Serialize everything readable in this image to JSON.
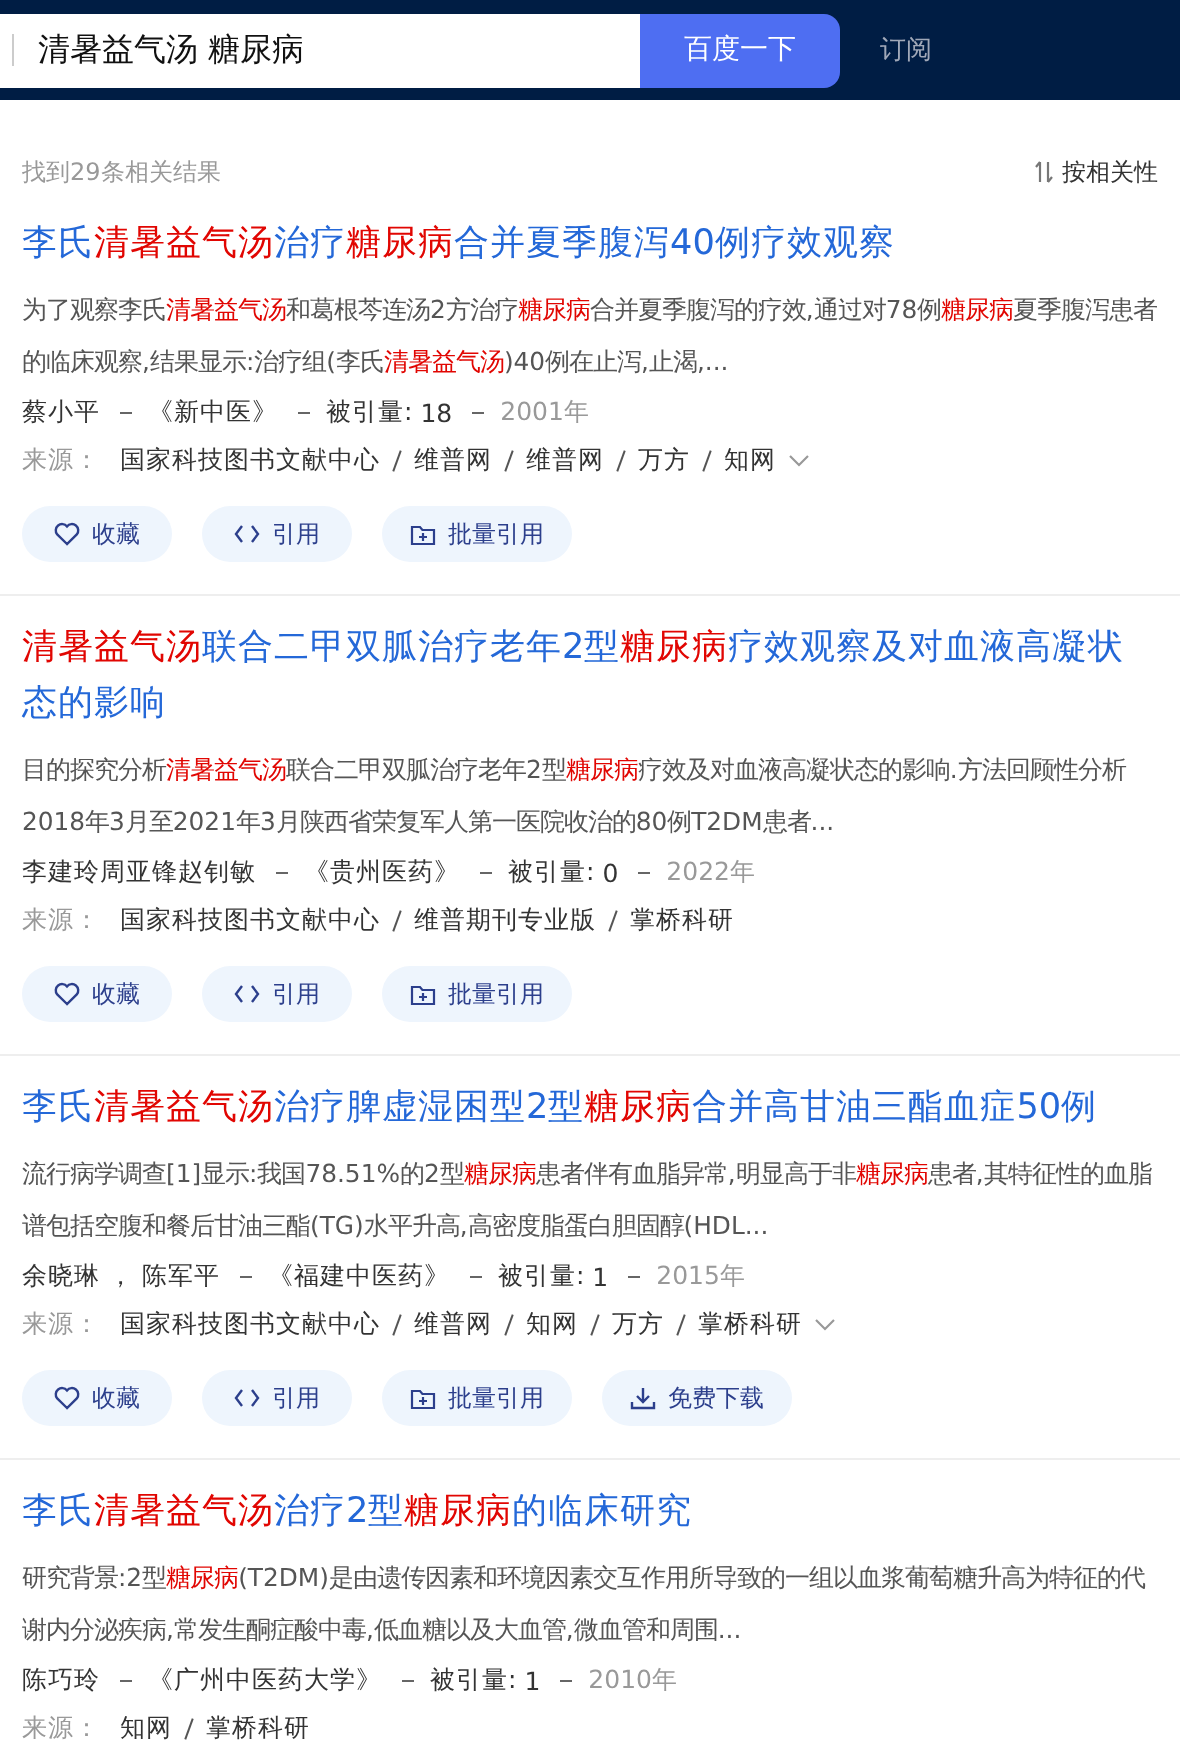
{
  "search": {
    "value": "清暑益气汤 糖尿病",
    "button": "百度一下",
    "subscribe": "订阅"
  },
  "summary": {
    "count": "找到29条相关结果",
    "sort": "按相关性"
  },
  "results": [
    {
      "title": [
        {
          "text": "李氏",
          "hit": false
        },
        {
          "text": "清暑益气汤",
          "hit": true
        },
        {
          "text": "治疗",
          "hit": false
        },
        {
          "text": "糖尿病",
          "hit": true
        },
        {
          "text": "合并夏季腹泻40例疗效观察",
          "hit": false
        }
      ],
      "abstract": [
        {
          "text": "为了观察李氏",
          "hit": false
        },
        {
          "text": "清暑益气汤",
          "hit": true
        },
        {
          "text": "和葛根芩连汤2方治疗",
          "hit": false
        },
        {
          "text": "糖尿病",
          "hit": true
        },
        {
          "text": "合并夏季腹泻的疗效,通过对78例",
          "hit": false
        },
        {
          "text": "糖尿病",
          "hit": true
        },
        {
          "text": "夏季腹泻患者的临床观察,结果显示:治疗组(李氏",
          "hit": false
        },
        {
          "text": "清暑益气汤",
          "hit": true
        },
        {
          "text": ")40例在止泻,止渴,...",
          "hit": false
        }
      ],
      "authors": "蔡小平",
      "journal": "《新中医》",
      "cited_label": "被引量:",
      "cited": "18",
      "year": "2001年",
      "source_label": "来源：",
      "sources": [
        "国家科技图书文献中心",
        "维普网",
        "维普网",
        "万方",
        "知网"
      ],
      "has_more": true,
      "actions": [
        {
          "kind": "favorite",
          "label": "收藏"
        },
        {
          "kind": "cite",
          "label": "引用"
        },
        {
          "kind": "batch",
          "label": "批量引用"
        }
      ]
    },
    {
      "title": [
        {
          "text": "清暑益气汤",
          "hit": true
        },
        {
          "text": "联合二甲双胍治疗老年2型",
          "hit": false
        },
        {
          "text": "糖尿病",
          "hit": true
        },
        {
          "text": "疗效观察及对血液高凝状态的影响",
          "hit": false
        }
      ],
      "abstract": [
        {
          "text": "目的探究分析",
          "hit": false
        },
        {
          "text": "清暑益气汤",
          "hit": true
        },
        {
          "text": "联合二甲双胍治疗老年2型",
          "hit": false
        },
        {
          "text": "糖尿病",
          "hit": true
        },
        {
          "text": "疗效及对血液高凝状态的影响.方法回顾性分析2018年3月至2021年3月陕西省荣复军人第一医院收治的80例T2DM患者...",
          "hit": false
        }
      ],
      "authors": "李建玲周亚锋赵钊敏",
      "journal": "《贵州医药》",
      "cited_label": "被引量:",
      "cited": "0",
      "year": "2022年",
      "source_label": "来源：",
      "sources": [
        "国家科技图书文献中心",
        "维普期刊专业版",
        "掌桥科研"
      ],
      "has_more": false,
      "actions": [
        {
          "kind": "favorite",
          "label": "收藏"
        },
        {
          "kind": "cite",
          "label": "引用"
        },
        {
          "kind": "batch",
          "label": "批量引用"
        }
      ]
    },
    {
      "title": [
        {
          "text": "李氏",
          "hit": false
        },
        {
          "text": "清暑益气汤",
          "hit": true
        },
        {
          "text": "治疗脾虚湿困型2型",
          "hit": false
        },
        {
          "text": "糖尿病",
          "hit": true
        },
        {
          "text": "合并高甘油三酯血症50例",
          "hit": false
        }
      ],
      "abstract": [
        {
          "text": "流行病学调查[1]显示:我国78.51%的2型",
          "hit": false
        },
        {
          "text": "糖尿病",
          "hit": true
        },
        {
          "text": "患者伴有血脂异常,明显高于非",
          "hit": false
        },
        {
          "text": "糖尿病",
          "hit": true
        },
        {
          "text": "患者,其特征性的血脂谱包括空腹和餐后甘油三酯(TG)水平升高,高密度脂蛋白胆固醇(HDL...",
          "hit": false
        }
      ],
      "authors": "余晓琳 ， 陈军平",
      "journal": "《福建中医药》",
      "cited_label": "被引量:",
      "cited": "1",
      "year": "2015年",
      "source_label": "来源：",
      "sources": [
        "国家科技图书文献中心",
        "维普网",
        "知网",
        "万方",
        "掌桥科研"
      ],
      "has_more": true,
      "actions": [
        {
          "kind": "favorite",
          "label": "收藏"
        },
        {
          "kind": "cite",
          "label": "引用"
        },
        {
          "kind": "batch",
          "label": "批量引用"
        },
        {
          "kind": "download",
          "label": "免费下载"
        }
      ]
    },
    {
      "title": [
        {
          "text": "李氏",
          "hit": false
        },
        {
          "text": "清暑益气汤",
          "hit": true
        },
        {
          "text": "治疗2型",
          "hit": false
        },
        {
          "text": "糖尿病",
          "hit": true
        },
        {
          "text": "的临床研究",
          "hit": false
        }
      ],
      "abstract": [
        {
          "text": "研究背景:2型",
          "hit": false
        },
        {
          "text": "糖尿病",
          "hit": true
        },
        {
          "text": "(T2DM)是由遗传因素和环境因素交互作用所导致的一组以血浆葡萄糖升高为特征的代谢内分泌疾病,常发生酮症酸中毒,低血糖以及大血管,微血管和周围...",
          "hit": false
        }
      ],
      "authors": "陈巧玲",
      "journal": "《广州中医药大学》",
      "cited_label": "被引量:",
      "cited": "1",
      "year": "2010年",
      "source_label": "来源：",
      "sources": [
        "知网",
        "掌桥科研"
      ],
      "has_more": false
    }
  ]
}
